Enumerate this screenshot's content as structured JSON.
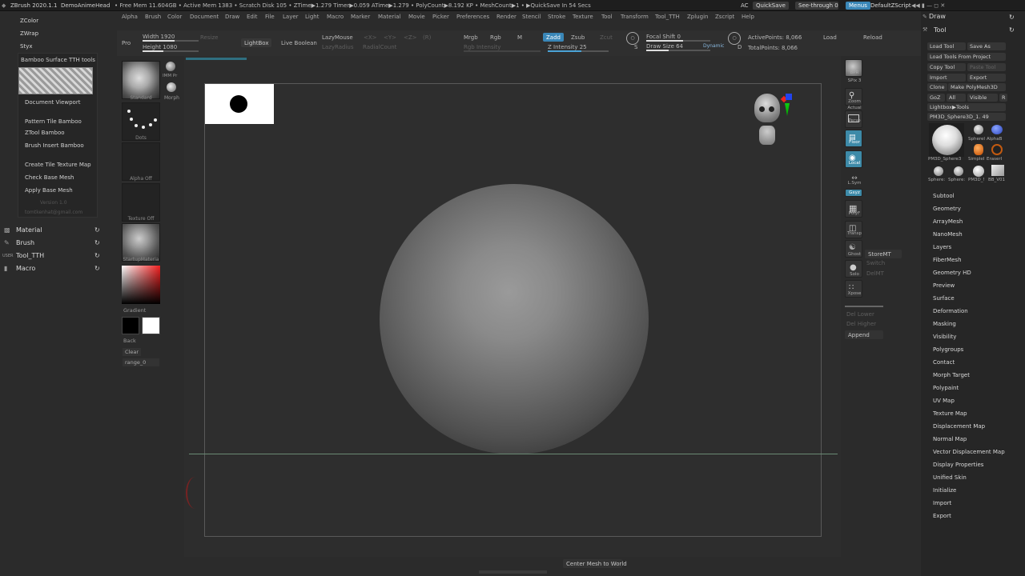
{
  "titlebar": {
    "app": "ZBrush 2020.1.1",
    "project": "DemoAnimeHead",
    "stats": "• Free Mem 11.604GB • Active Mem 1383 • Scratch Disk 105 •  ZTime▶1.279 Timer▶0.059 ATime▶1.279 • PolyCount▶8.192 KP • MeshCount▶1 • ▶QuickSave In 54 Secs",
    "ac": "AC",
    "quicksave": "QuickSave",
    "seethrough": "See-through  0",
    "menus": "Menus",
    "script": "DefaultZScript"
  },
  "menubar": [
    "Alpha",
    "Brush",
    "Color",
    "Document",
    "Draw",
    "Edit",
    "File",
    "Layer",
    "Light",
    "Macro",
    "Marker",
    "Material",
    "Movie",
    "Picker",
    "Preferences",
    "Render",
    "Stencil",
    "Stroke",
    "Texture",
    "Tool",
    "Transform",
    "Tool_TTH",
    "Zplugin",
    "Zscript",
    "Help"
  ],
  "leftmenu": {
    "top_items": [
      "ZColor",
      "ZWrap",
      "Styx"
    ],
    "header": "Bamboo Surface TTH tools",
    "items": [
      "Document Viewport",
      "Pattern Tile Bamboo",
      "ZTool Bamboo",
      "Brush Insert Bamboo",
      "Create Tile Texture Map",
      "Check Base Mesh",
      "Apply Base Mesh"
    ],
    "version": "Version 1.0",
    "email": "tomtkenhat@gmail.com"
  },
  "palettes": [
    {
      "label": "Material",
      "icon": "material-icon"
    },
    {
      "label": "Brush",
      "icon": "brush-icon"
    },
    {
      "label": "Tool_TTH",
      "icon": "user-icon"
    },
    {
      "label": "Macro",
      "icon": "macro-icon"
    }
  ],
  "topshelf": {
    "pro": "Pro",
    "width": "Width 1920",
    "height": "Height 1080",
    "resize": "Resize",
    "lightbox": "LightBox",
    "liveboolean": "Live Boolean",
    "lazymouse": "LazyMouse",
    "lazyradius": "LazyRadius",
    "radialcount": "RadialCount",
    "sx": "<X>",
    "sy": "<Y>",
    "sz": "<Z>",
    "sr": "(R)",
    "mrgb": "Mrgb",
    "rgb": "Rgb",
    "m": "M",
    "rgbintensity": "Rgb Intensity",
    "zadd": "Zadd",
    "zsub": "Zsub",
    "zcut": "Zcut",
    "zintensity": "Z Intensity 25",
    "focalshift": "Focal Shift 0",
    "drawsize": "Draw Size 64",
    "dynamic": "Dynamic",
    "activepoints": "ActivePoints: 8,066",
    "totalpoints": "TotalPoints: 8,066",
    "load": "Load",
    "reload": "Reload",
    "s": "S",
    "d": "D"
  },
  "leftshelf": {
    "brush": "Standard",
    "imm": "IMM Pr",
    "morph": "Morph",
    "stroke": "Dots",
    "alpha": "Alpha Off",
    "texture": "Texture Off",
    "material": "StartupMateria",
    "gradient": "Gradient",
    "back": "Back",
    "clear": "Clear",
    "range": "range_0"
  },
  "rightshelf": [
    "BPR",
    "SPix 3",
    "Zoom",
    "Actual",
    "Persp",
    "Floor",
    "Local",
    "L.Sym",
    "Gxyz",
    "PolyF",
    "Transp",
    "Ghost",
    "Solo",
    "Xpose"
  ],
  "rightshelf_extra": {
    "storemt": "StoreMT",
    "switch": "Switch",
    "delmt": "DelMT",
    "dellower": "Del Lower",
    "delhigher": "Del Higher",
    "append": "Append"
  },
  "status": {
    "bottom": "Center Mesh to World"
  },
  "rightpanel": {
    "draw": "Draw",
    "tool": "Tool",
    "loadtool": "Load Tool",
    "saveas": "Save As",
    "loadproject": "Load Tools From Project",
    "copytool": "Copy Tool",
    "pastetool": "Paste Tool",
    "import": "Import",
    "export": "Export",
    "clone": "Clone",
    "makepoly": "Make PolyMesh3D",
    "goz": "GoZ",
    "all": "All",
    "visible": "Visible",
    "r": "R",
    "lightbox": "Lightbox▶Tools",
    "current": "PM3D_Sphere3D_1. 49",
    "tools": [
      "PM3D_Sphere3",
      "SphereI",
      "AlphaB",
      "SimpleI",
      "EraserI",
      "Sphere:",
      "Sphere:",
      "PM3D_!",
      "BB_V01"
    ],
    "subpalettes": [
      "Subtool",
      "Geometry",
      "ArrayMesh",
      "NanoMesh",
      "Layers",
      "FiberMesh",
      "Geometry HD",
      "Preview",
      "Surface",
      "Deformation",
      "Masking",
      "Visibility",
      "Polygroups",
      "Contact",
      "Morph Target",
      "Polypaint",
      "UV Map",
      "Texture Map",
      "Displacement Map",
      "Normal Map",
      "Vector Displacement Map",
      "Display Properties",
      "Unified Skin",
      "Initialize",
      "Import",
      "Export"
    ]
  },
  "colors": {
    "accent": "#3a87b8",
    "background": "#2b2b2b",
    "panel": "#262626"
  }
}
